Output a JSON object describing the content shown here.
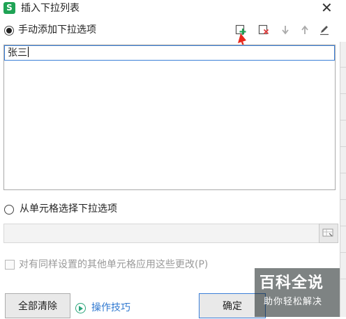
{
  "window": {
    "title": "插入下拉列表",
    "app_icon_letter": "S",
    "close_glyph": "✕"
  },
  "manual": {
    "radio_label": "手动添加下拉选项",
    "selected": true,
    "toolbar": {
      "add": "add-item-icon",
      "delete": "delete-item-icon",
      "move_down": "arrow-down-icon",
      "move_up": "arrow-up-icon",
      "edit": "pencil-icon"
    },
    "items": [
      "张三"
    ]
  },
  "from_cells": {
    "radio_label": "从单元格选择下拉选项",
    "selected": false,
    "input_value": ""
  },
  "apply_same": {
    "label": "对有同样设置的其他单元格应用这些更改(P)",
    "checked": false,
    "enabled": false
  },
  "footer": {
    "clear_all": "全部清除",
    "tips": "操作技巧",
    "ok": "确定"
  },
  "watermark": {
    "title": "百科全说",
    "subtitle": "助你轻松解决"
  },
  "colors": {
    "accent": "#1fa355",
    "link": "#2f78d0",
    "annotation_arrow": "#e8281c"
  }
}
